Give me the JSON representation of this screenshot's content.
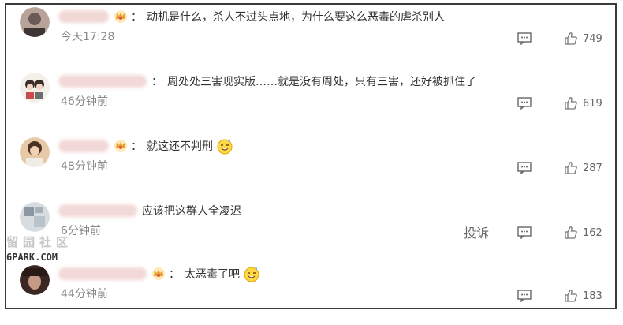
{
  "comments": [
    {
      "text": "动机是什么，杀人不过头点地，为什么要这么恶毒的虐杀别人",
      "time": "今天17:28",
      "likes": "749",
      "vip": true,
      "emoji": false
    },
    {
      "text": "周处处三害现实版……就是没有周处，只有三害，还好被抓住了",
      "time": "46分钟前",
      "likes": "619",
      "vip": false,
      "emoji": false
    },
    {
      "text": "就这还不判刑",
      "time": "48分钟前",
      "likes": "287",
      "vip": true,
      "emoji": true
    },
    {
      "text": "应该把这群人全凌迟",
      "time": "6分钟前",
      "likes": "162",
      "vip": false,
      "emoji": false
    },
    {
      "text": "太恶毒了吧",
      "time": "44分钟前",
      "likes": "183",
      "vip": true,
      "emoji": true
    }
  ],
  "report_label": "投诉",
  "separator": "：",
  "watermark": {
    "top": "留园社区",
    "bottom": "6PARK.COM"
  }
}
